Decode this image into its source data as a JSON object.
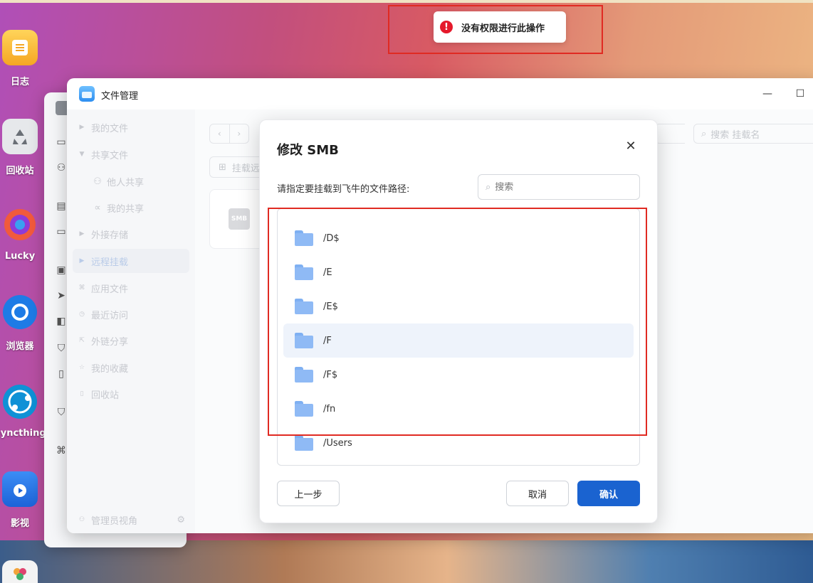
{
  "dock": {
    "items": [
      {
        "label": "日志",
        "icon": "log-icon"
      },
      {
        "label": "回收站",
        "icon": "recycle-bin-icon"
      },
      {
        "label": "Lucky",
        "icon": "lucky-icon"
      },
      {
        "label": "浏览器",
        "icon": "browser-icon"
      },
      {
        "label": "Syncthing",
        "icon": "syncthing-icon"
      },
      {
        "label": "影视",
        "icon": "video-icon"
      }
    ]
  },
  "toast": {
    "icon": "error-icon",
    "message": "没有权限进行此操作"
  },
  "file_manager": {
    "title": "文件管理",
    "sidebar": {
      "items": [
        {
          "label": "我的文件"
        },
        {
          "label": "共享文件"
        },
        {
          "label": "他人共享"
        },
        {
          "label": "我的共享"
        },
        {
          "label": "外接存储"
        },
        {
          "label": "远程挂载"
        },
        {
          "label": "应用文件"
        },
        {
          "label": "最近访问"
        },
        {
          "label": "外链分享"
        },
        {
          "label": "我的收藏"
        },
        {
          "label": "回收站"
        }
      ],
      "footer": "管理员视角"
    },
    "toolbar": {
      "mount_button": "挂载远",
      "search_placeholder": "搜索 挂载名"
    },
    "card": {
      "tile": "SMB"
    }
  },
  "modal": {
    "title": "修改 SMB",
    "prompt": "请指定要挂载到飞牛的文件路径:",
    "search_placeholder": "搜索",
    "folders": [
      "/D$",
      "/E",
      "/E$",
      "/F",
      "/F$",
      "/fn",
      "/Users"
    ],
    "buttons": {
      "prev": "上一步",
      "cancel": "取消",
      "confirm": "确认"
    }
  },
  "colors": {
    "accent": "#1a63d0",
    "error": "#e5192b",
    "highlight_outline": "#e02a22"
  }
}
